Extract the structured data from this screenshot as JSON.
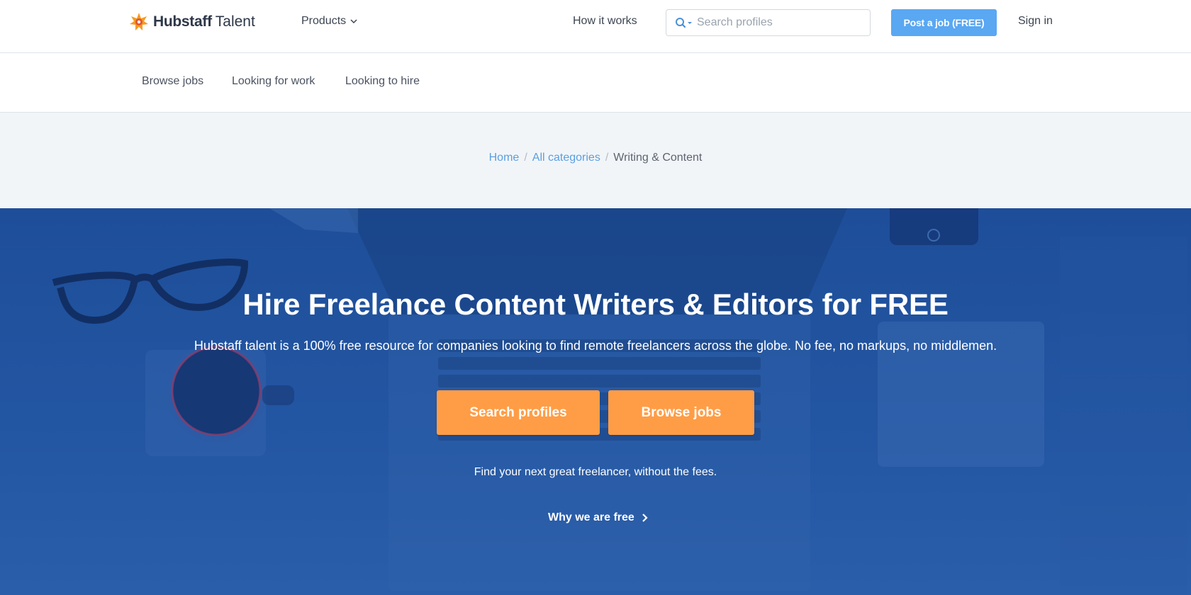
{
  "header": {
    "logo_strong": "Hubstaff",
    "logo_light": "Talent",
    "products_label": "Products",
    "how_label": "How it works",
    "search_placeholder": "Search profiles",
    "post_label": "Post a job (FREE)",
    "signin_label": "Sign in"
  },
  "subnav": {
    "items": [
      "Browse jobs",
      "Looking for work",
      "Looking to hire"
    ]
  },
  "breadcrumb": {
    "home": "Home",
    "categories": "All categories",
    "current": "Writing & Content",
    "separator": "/"
  },
  "hero": {
    "title": "Hire Freelance Content Writers & Editors for FREE",
    "subtitle": "Hubstaff talent is a 100% free resource for companies looking to find remote freelancers across the globe. No fee, no markups, no middlemen.",
    "primary_button": "Search profiles",
    "secondary_button": "Browse jobs",
    "note": "Find your next great freelancer, without the fees.",
    "why_link": "Why we are free"
  },
  "colors": {
    "accent_blue": "#5aa7f2",
    "hero_blue": "#2356a3",
    "orange": "#ff9d46",
    "link_blue": "#5a9fe0"
  },
  "icons": [
    "logo-star-icon",
    "chevron-down-icon",
    "search-icon",
    "chevron-right-icon"
  ]
}
